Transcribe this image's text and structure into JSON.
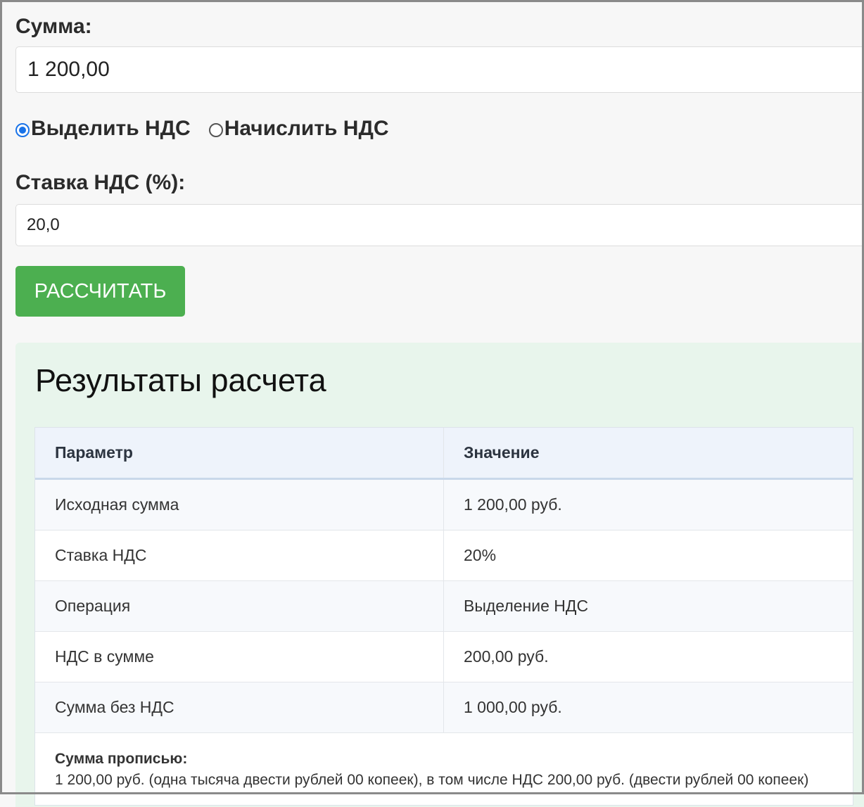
{
  "form": {
    "sum_label": "Сумма:",
    "sum_value": "1 200,00",
    "mode_options": [
      {
        "label": "Выделить НДС",
        "checked": true
      },
      {
        "label": "Начислить НДС",
        "checked": false
      }
    ],
    "rate_label": "Ставка НДС (%):",
    "rate_value": "20,0",
    "calc_button": "РАССЧИТАТЬ"
  },
  "results": {
    "title": "Результаты расчета",
    "columns": [
      "Параметр",
      "Значение"
    ],
    "rows": [
      {
        "param": "Исходная сумма",
        "value": "1 200,00 руб."
      },
      {
        "param": "Ставка НДС",
        "value": "20%"
      },
      {
        "param": "Операция",
        "value": "Выделение НДС"
      },
      {
        "param": "НДС в сумме",
        "value": "200,00 руб."
      },
      {
        "param": "Сумма без НДС",
        "value": "1 000,00 руб."
      }
    ],
    "words_title": "Сумма прописью:",
    "words_text": "1 200,00 руб. (одна тысяча двести рублей 00 копеек), в том числе НДС 200,00 руб. (двести рублей 00 копеек)"
  },
  "colors": {
    "button": "#4caf50",
    "results_bg": "#e8f5ec",
    "radio_accent": "#1a73e8"
  }
}
